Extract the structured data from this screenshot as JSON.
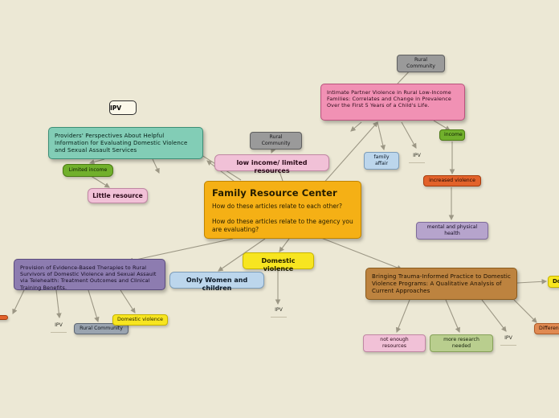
{
  "diagram": {
    "type": "mind-map",
    "background_color": "#ece8d5",
    "center": {
      "title": "Family Resource Center",
      "question_1": "How do these articles relate to each other?",
      "question_2": "How do these articles relate to the agency you are evaluating?",
      "color": "#f5b015"
    },
    "articles": [
      {
        "id": "article-ipv-rural",
        "text": "Intimate Partner Violence in Rural Low-Income Families: Correlates and Change in Prevalence Over the First 5 Years of a Child's Life.",
        "color": "#f191b4"
      },
      {
        "id": "article-providers-perspectives",
        "text": "Providers' Perspectives About Helpful Information for Evaluating Domestic Violence and Sexual Assault Services",
        "color": "#82cdb6"
      },
      {
        "id": "article-telehealth-therapies",
        "text": "Provision of Evidence-Based Therapies to Rural Survivors of Domestic Violence and Sexual Assault via Telehealth: Treatment Outcomes and Clinical Training Benefits.",
        "color": "#8d7cb0"
      },
      {
        "id": "article-trauma-informed",
        "text": "Bringing Trauma-Informed Practice to Domestic Violence Programs: A Qualitative Analysis of Current Approaches",
        "color": "#bd833f"
      }
    ],
    "tags": {
      "ipv_box": "IPV",
      "rural_community_top": "Rural Community",
      "rural_community_mid": "Rural Community",
      "rural_community_bottom": "Rural Community",
      "family_affair": "family affair",
      "income": "income",
      "increased_violence": "increased violence",
      "mental_and_physical_health": "mental and physical health",
      "limited_income": "Limited income",
      "little_resource": "Little resource",
      "low_income_limited_resources": "low income/ limited resources",
      "domestic_violence_center": "Domestic violence",
      "only_women_and_children": "Only Women and children",
      "domestic_violence_bottom_left": "Domestic violence",
      "not_enough_resources": "not enough resources",
      "more_research_needed": "more research needed",
      "domestic_violence_right": "Do",
      "different_things_right": "Different t",
      "red_cut_left": "",
      "ipv_plain_a": "IPV",
      "ipv_plain_b": "IPV",
      "ipv_plain_c": "IPV",
      "ipv_plain_d": "IPV"
    },
    "colors": {
      "gray": "#9a9a9a",
      "blue_gray": "#9aa4b0",
      "green": "#71b02c",
      "orange": "#e2622b",
      "lilac": "#b6a4cc",
      "light_blue": "#bcd6ec",
      "pink_light": "#f1c1d7",
      "green_light": "#b9ce8e",
      "yellow": "#f7e520",
      "orange_light": "#e08a52",
      "edge": "#9c9785"
    }
  }
}
